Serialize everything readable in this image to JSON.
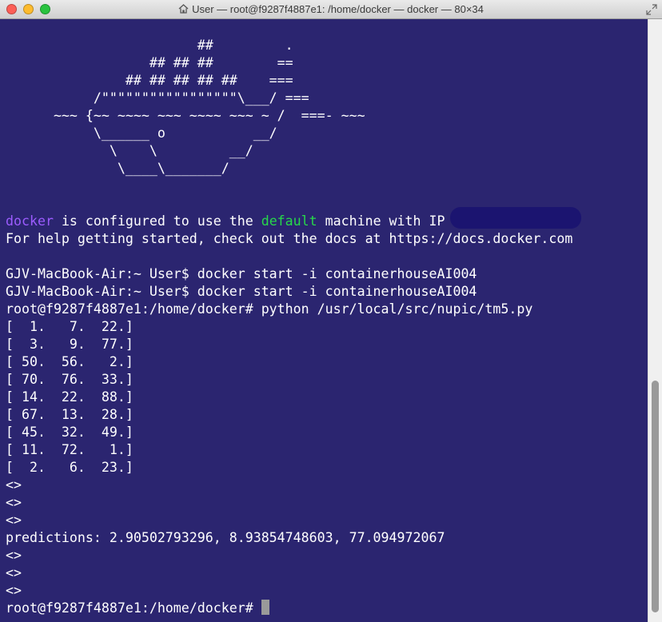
{
  "window": {
    "title": "User — root@f9287f4887e1: /home/docker — docker — 80×34"
  },
  "terminal": {
    "logo_lines": [
      "                        ##         .",
      "                  ## ## ##        ==",
      "               ## ## ## ## ##    ===",
      "           /\"\"\"\"\"\"\"\"\"\"\"\"\"\"\"\"\"\\___/ ===",
      "      ~~~ {~~ ~~~~ ~~~ ~~~~ ~~~ ~ /  ===- ~~~",
      "           \\______ o           __/",
      "             \\    \\         __/",
      "              \\____\\_______/"
    ],
    "info": {
      "docker": "docker",
      "is_configured": " is configured to use the ",
      "default": "default",
      "machine_with_ip": " machine with IP "
    },
    "help_line": "For help getting started, check out the docs at https://docs.docker.com",
    "commands": [
      "GJV-MacBook-Air:~ User$ docker start -i containerhouseAI004",
      "GJV-MacBook-Air:~ User$ docker start -i containerhouseAI004",
      "root@f9287f4887e1:/home/docker# python /usr/local/src/nupic/tm5.py"
    ],
    "matrix": [
      "[  1.   7.  22.]",
      "[  3.   9.  77.]",
      "[ 50.  56.   2.]",
      "[ 70.  76.  33.]",
      "[ 14.  22.  88.]",
      "[ 67.  13.  28.]",
      "[ 45.  32.  49.]",
      "[ 11.  72.   1.]",
      "[  2.   6.  23.]"
    ],
    "marker": "<>",
    "predictions": "predictions: 2.90502793296, 8.93854748603, 77.094972067",
    "prompt": "root@f9287f4887e1:/home/docker# "
  }
}
